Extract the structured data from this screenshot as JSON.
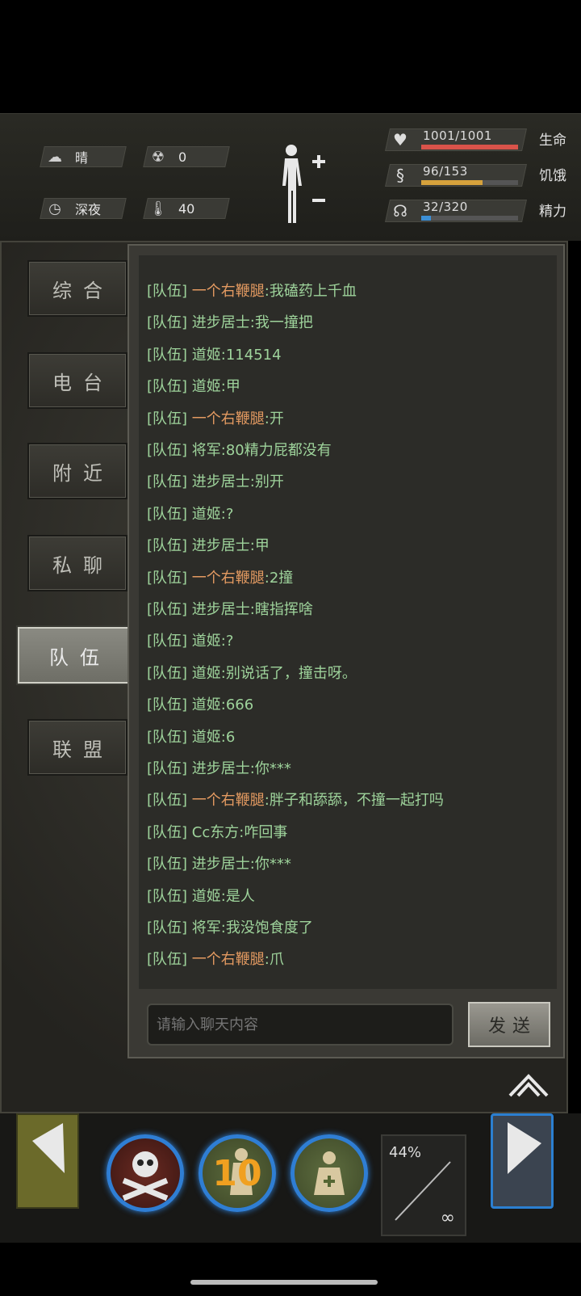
{
  "status": {
    "weather": "晴",
    "radiation": "0",
    "time_of_day": "深夜",
    "temperature": "40"
  },
  "bars": {
    "health": {
      "value": "1001/1001",
      "label": "生命",
      "fraction": 1.0,
      "color": "#d9534a"
    },
    "hunger": {
      "value": "96/153",
      "label": "饥饿",
      "fraction": 0.63,
      "color": "#d6a23c"
    },
    "energy": {
      "value": "32/320",
      "label": "精力",
      "fraction": 0.1,
      "color": "#3c8fd6"
    }
  },
  "tabs": [
    "综合",
    "电台",
    "附近",
    "私聊",
    "队伍",
    "联盟"
  ],
  "active_tab": "队伍",
  "chat": {
    "tag": "[队伍]",
    "messages": [
      {
        "name": "一个右鞭腿",
        "text": "我磕药上千血",
        "color": "orange"
      },
      {
        "name": "进步居士",
        "text": "我一撞把",
        "color": "green"
      },
      {
        "name": "道姬",
        "text": "114514",
        "color": "green"
      },
      {
        "name": "道姬",
        "text": "甲",
        "color": "green"
      },
      {
        "name": "一个右鞭腿",
        "text": "开",
        "color": "orange"
      },
      {
        "name": "将军",
        "text": "80精力屁都没有",
        "color": "green"
      },
      {
        "name": "进步居士",
        "text": "别开",
        "color": "green"
      },
      {
        "name": "道姬",
        "text": "?",
        "color": "green"
      },
      {
        "name": "进步居士",
        "text": "甲",
        "color": "green"
      },
      {
        "name": "一个右鞭腿",
        "text": "2撞",
        "color": "orange"
      },
      {
        "name": "进步居士",
        "text": "瞎指挥啥",
        "color": "green"
      },
      {
        "name": "道姬",
        "text": "?",
        "color": "green"
      },
      {
        "name": "道姬",
        "text": "别说话了，撞击呀。",
        "color": "green"
      },
      {
        "name": "道姬",
        "text": "666",
        "color": "green"
      },
      {
        "name": "道姬",
        "text": "6",
        "color": "green"
      },
      {
        "name": "进步居士",
        "text": "你***",
        "color": "green"
      },
      {
        "name": "一个右鞭腿",
        "text": "胖子和舔舔，不撞一起打吗",
        "color": "orange"
      },
      {
        "name": "Cc东方",
        "text": "咋回事",
        "color": "green"
      },
      {
        "name": "进步居士",
        "text": "你***",
        "color": "green"
      },
      {
        "name": "道姬",
        "text": "是人",
        "color": "green"
      },
      {
        "name": "将军",
        "text": "我没饱食度了",
        "color": "green"
      },
      {
        "name": "一个右鞭腿",
        "text": "爪",
        "color": "orange"
      }
    ],
    "input_placeholder": "请输入聊天内容",
    "send_label": "发送"
  },
  "action_bar": {
    "zombie_count": "10",
    "ammo_percent": "44%",
    "ammo_infinite": "∞"
  }
}
